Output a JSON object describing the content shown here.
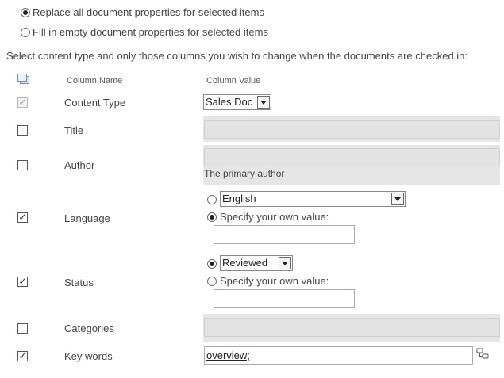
{
  "options": {
    "replace_all": "Replace all document properties for selected items",
    "fill_empty": "Fill in empty document properties for selected items",
    "selected": "replace_all"
  },
  "instructions": "Select content type and only those columns you wish to change when the documents are checked in:",
  "table": {
    "col_name_header": "Column Name",
    "col_value_header": "Column Value"
  },
  "rows": {
    "content_type": {
      "name": "Content Type",
      "checked": true,
      "disabled": true,
      "value": "Sales Doc"
    },
    "title": {
      "name": "Title",
      "checked": false
    },
    "author": {
      "name": "Author",
      "checked": false,
      "hint": "The primary author"
    },
    "language": {
      "name": "Language",
      "checked": true,
      "dropdown_value": "English",
      "specify_label": "Specify your own value:",
      "selected": "specify"
    },
    "status": {
      "name": "Status",
      "checked": true,
      "dropdown_value": "Reviewed",
      "specify_label": "Specify your own value:",
      "selected": "dropdown"
    },
    "categories": {
      "name": "Categories",
      "checked": false
    },
    "key_words": {
      "name": "Key words",
      "checked": true,
      "value": "overview;"
    }
  },
  "icons": {
    "header_icon": "select-all-icon",
    "key_words_icon": "term-picker-icon"
  }
}
